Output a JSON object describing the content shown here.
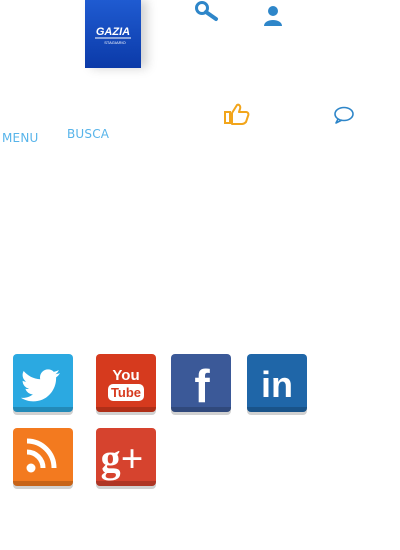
{
  "brand": {
    "logo_text": "GAZIA",
    "logo_subtext": "STAGIARIO",
    "logo_color": "#0b3aa8"
  },
  "header": {
    "icons": [
      "search-icon",
      "user-icon"
    ]
  },
  "nav": {
    "menu_label": "MENU",
    "busca_label": "BUSCA",
    "icons": [
      "like-icon",
      "comment-icon"
    ],
    "accent": "#57b4ea",
    "like_color": "#f2a51b"
  },
  "social": {
    "networks": [
      {
        "name": "twitter",
        "label": "Twitter",
        "color": "#2ba9e1"
      },
      {
        "name": "youtube",
        "label": "YouTube",
        "text_top": "You",
        "text_bottom": "Tube",
        "color": "#d63a1e"
      },
      {
        "name": "facebook",
        "label": "Facebook",
        "text": "f",
        "color": "#3b5998"
      },
      {
        "name": "linkedin",
        "label": "LinkedIn",
        "text": "in",
        "color": "#1f66a8"
      },
      {
        "name": "rss",
        "label": "RSS",
        "color": "#f37a1f"
      },
      {
        "name": "google-plus",
        "label": "Google+",
        "text": "g+",
        "color": "#d6432e"
      }
    ]
  }
}
